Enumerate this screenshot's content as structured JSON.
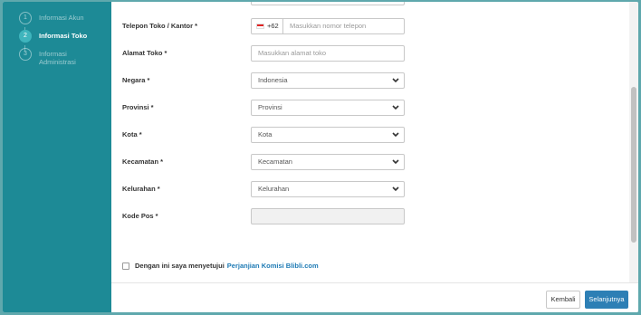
{
  "sidebar": {
    "steps": [
      {
        "number": "1",
        "label": "Informasi Akun"
      },
      {
        "number": "2",
        "label": "Informasi Toko"
      },
      {
        "number": "3",
        "label": "Informasi Administrasi"
      }
    ],
    "active_step": 2
  },
  "form": {
    "phone": {
      "label": "Telepon Toko / Kantor *",
      "prefix": "+62",
      "placeholder": "Masukkan nomor telepon"
    },
    "address": {
      "label": "Alamat Toko *",
      "placeholder": "Masukkan alamat toko"
    },
    "country": {
      "label": "Negara *",
      "value": "Indonesia"
    },
    "province": {
      "label": "Provinsi *",
      "value": "Provinsi"
    },
    "city": {
      "label": "Kota *",
      "value": "Kota"
    },
    "district": {
      "label": "Kecamatan *",
      "value": "Kecamatan"
    },
    "village": {
      "label": "Kelurahan *",
      "value": "Kelurahan"
    },
    "postal": {
      "label": "Kode Pos *",
      "value": ""
    }
  },
  "agreement": {
    "text": "Dengan ini saya menyetujui",
    "link": "Perjanjian Komisi Blibli.com"
  },
  "footer": {
    "back_label": "Kembali",
    "next_label": "Selanjutnya"
  },
  "colors": {
    "sidebar": "#1d8a96",
    "active_step": "#3fb5bd",
    "primary_button": "#2d7fb5",
    "link": "#1f7bb5"
  }
}
